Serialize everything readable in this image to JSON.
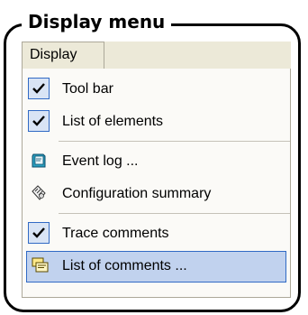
{
  "caption": "Display menu",
  "menubar": {
    "title": "Display"
  },
  "menu": {
    "items": [
      {
        "label": "Tool bar",
        "icon": "checkmark-icon",
        "checked": true
      },
      {
        "label": "List of elements",
        "icon": "checkmark-icon",
        "checked": true
      },
      {
        "label": "Event log ...",
        "icon": "event-log-book-icon",
        "checked": false
      },
      {
        "label": "Configuration summary",
        "icon": "configuration-summary-icon",
        "checked": false
      },
      {
        "label": "Trace comments",
        "icon": "checkmark-icon",
        "checked": true
      },
      {
        "label": "List of comments ...",
        "icon": "comments-list-icon",
        "checked": false,
        "highlighted": true
      }
    ]
  },
  "colors": {
    "highlight_bg": "#c1d2ee",
    "highlight_border": "#316ac5",
    "menubar_bg": "#ece9d8",
    "menu_bg": "#fbfaf7"
  }
}
